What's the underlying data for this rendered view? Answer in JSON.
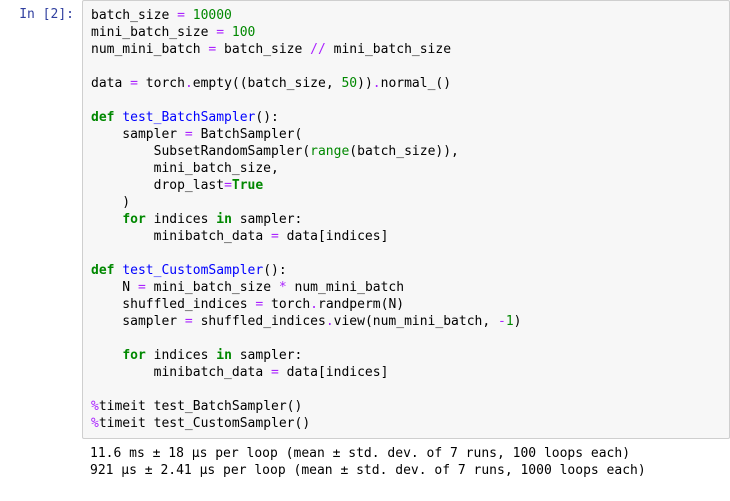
{
  "prompt": {
    "label": "In [2]:"
  },
  "code": {
    "l1_a": "batch_size ",
    "l1_op": "=",
    "l1_b": " ",
    "l1_num": "10000",
    "l2_a": "mini_batch_size ",
    "l2_op": "=",
    "l2_b": " ",
    "l2_num": "100",
    "l3_a": "num_mini_batch ",
    "l3_op": "=",
    "l3_b": " batch_size ",
    "l3_op2": "//",
    "l3_c": " mini_batch_size",
    "l5_a": "data ",
    "l5_op": "=",
    "l5_b": " torch",
    "l5_dot": ".",
    "l5_c": "empty((batch_size, ",
    "l5_num": "50",
    "l5_d": "))",
    "l5_dot2": ".",
    "l5_e": "normal_()",
    "l7_kw": "def",
    "l7_sp": " ",
    "l7_fn": "test_BatchSampler",
    "l7_tail": "():",
    "l8_a": "    sampler ",
    "l8_op": "=",
    "l8_b": " BatchSampler(",
    "l9_a": "        SubsetRandomSampler(",
    "l9_bi": "range",
    "l9_b": "(batch_size)),",
    "l10": "        mini_batch_size,",
    "l11_a": "        drop_last",
    "l11_op": "=",
    "l11_kw": "True",
    "l12": "    )",
    "l13_a": "    ",
    "l13_kw1": "for",
    "l13_b": " indices ",
    "l13_kw2": "in",
    "l13_c": " sampler:",
    "l14_a": "        minibatch_data ",
    "l14_op": "=",
    "l14_b": " data[indices]",
    "l16_kw": "def",
    "l16_sp": " ",
    "l16_fn": "test_CustomSampler",
    "l16_tail": "():",
    "l17_a": "    N ",
    "l17_op": "=",
    "l17_b": " mini_batch_size ",
    "l17_op2": "*",
    "l17_c": " num_mini_batch",
    "l18_a": "    shuffled_indices ",
    "l18_op": "=",
    "l18_b": " torch",
    "l18_dot": ".",
    "l18_c": "randperm(N)",
    "l19_a": "    sampler ",
    "l19_op": "=",
    "l19_b": " shuffled_indices",
    "l19_dot": ".",
    "l19_c": "view(num_mini_batch, ",
    "l19_op2": "-",
    "l19_num": "1",
    "l19_d": ")",
    "l21_a": "    ",
    "l21_kw1": "for",
    "l21_b": " indices ",
    "l21_kw2": "in",
    "l21_c": " sampler:",
    "l22_a": "        minibatch_data ",
    "l22_op": "=",
    "l22_b": " data[indices]",
    "l24_op": "%",
    "l24_a": "timeit test_BatchSampler()",
    "l25_op": "%",
    "l25_a": "timeit test_CustomSampler()"
  },
  "output": {
    "l1": "11.6 ms ± 18 µs per loop (mean ± std. dev. of 7 runs, 100 loops each)",
    "l2": "921 µs ± 2.41 µs per loop (mean ± std. dev. of 7 runs, 1000 loops each)"
  }
}
